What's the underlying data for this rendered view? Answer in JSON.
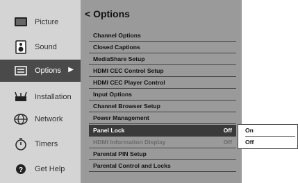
{
  "sidebar": {
    "items": [
      {
        "label": "Picture",
        "icon": "picture-icon"
      },
      {
        "label": "Sound",
        "icon": "sound-icon"
      },
      {
        "label": "Options",
        "icon": "options-icon",
        "active": true
      },
      {
        "label": "Installation",
        "icon": "installation-icon"
      },
      {
        "label": "Network",
        "icon": "network-icon"
      },
      {
        "label": "Timers",
        "icon": "timers-icon"
      },
      {
        "label": "Get Help",
        "icon": "help-icon"
      }
    ],
    "active_arrow": "▶"
  },
  "main": {
    "title": "< Options",
    "items": [
      {
        "label": "Channel Options",
        "value": ""
      },
      {
        "label": "Closed Captions",
        "value": ""
      },
      {
        "label": "MediaShare Setup",
        "value": ""
      },
      {
        "label": "HDMI CEC Control Setup",
        "value": ""
      },
      {
        "label": "HDMI CEC Player Control",
        "value": ""
      },
      {
        "label": "Input Options",
        "value": ""
      },
      {
        "label": "Channel Browser Setup",
        "value": ""
      },
      {
        "label": "Power Management",
        "value": ""
      },
      {
        "label": "Panel Lock",
        "value": "Off"
      },
      {
        "label": "HDMI Information Display",
        "value": "Off"
      },
      {
        "label": "Parental PIN Setup",
        "value": ""
      },
      {
        "label": "Parental Control and Locks",
        "value": ""
      }
    ]
  },
  "popup": {
    "options": [
      "On",
      "Off"
    ]
  },
  "colors": {
    "sidebar_bg": "#d4d4d4",
    "main_bg": "#9a9a9a",
    "selected_bg": "#3a3a3a",
    "active_sidebar_bg": "#4a4a4a"
  }
}
